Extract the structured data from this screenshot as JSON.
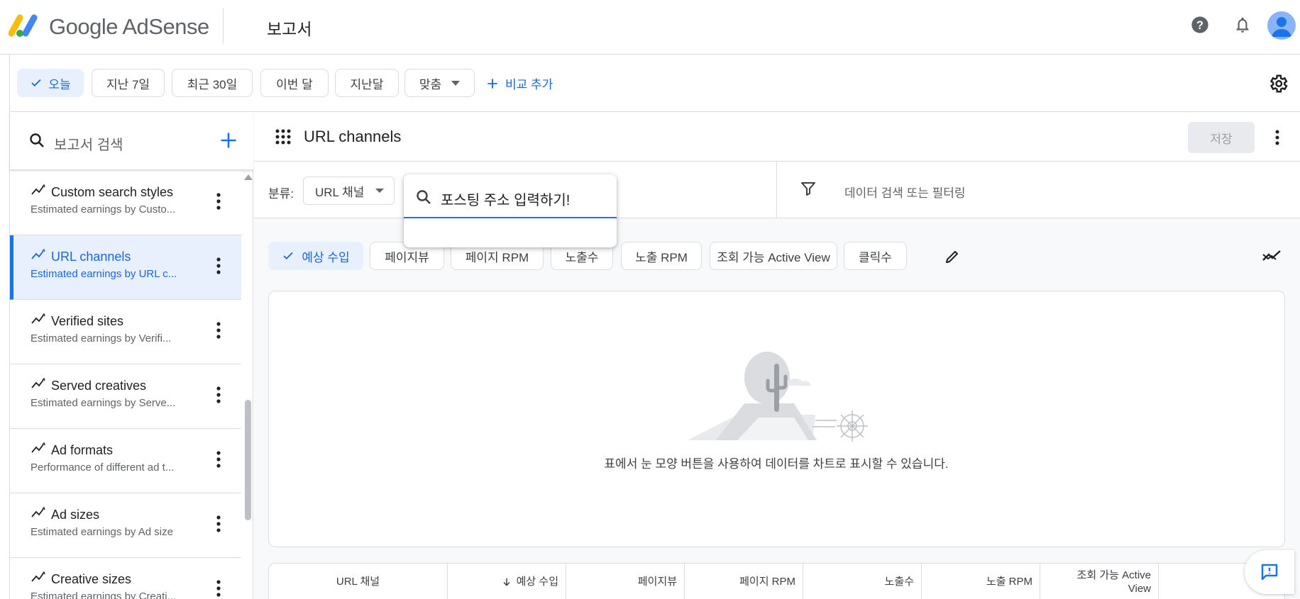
{
  "app": {
    "brand_word1": "Google",
    "brand_word2": "AdSense",
    "page_title": "보고서",
    "icons": [
      "help-icon",
      "notifications-icon",
      "account-avatar"
    ]
  },
  "date_filters": {
    "items": [
      "오늘",
      "지난 7일",
      "최근 30일",
      "이번 달",
      "지난달",
      "맞춤"
    ],
    "selected": "오늘",
    "add_compare": "비교 추가"
  },
  "sidebar": {
    "search_placeholder": "보고서 검색",
    "items": [
      {
        "title": "Custom search styles",
        "subtitle": "Estimated earnings by Custo..."
      },
      {
        "title": "URL channels",
        "subtitle": "Estimated earnings by URL c..."
      },
      {
        "title": "Verified sites",
        "subtitle": "Estimated earnings by Verifi..."
      },
      {
        "title": "Served creatives",
        "subtitle": "Estimated earnings by Serve..."
      },
      {
        "title": "Ad formats",
        "subtitle": "Performance of different ad t..."
      },
      {
        "title": "Ad sizes",
        "subtitle": "Estimated earnings by Ad size"
      },
      {
        "title": "Creative sizes",
        "subtitle": "Estimated earnings by Creati..."
      }
    ],
    "active_index": 1
  },
  "report": {
    "name": "URL channels",
    "save_label": "저장",
    "classification_label": "분류:",
    "classification_value": "URL 채널",
    "filter_placeholder": "데이터 검색 또는 필터링",
    "popover_input": "포스팅 주소 입력하기!"
  },
  "metrics": {
    "items": [
      "예상 수입",
      "페이지뷰",
      "페이지 RPM",
      "노출수",
      "노출 RPM",
      "조회 가능 Active View",
      "클릭수"
    ],
    "selected": "예상 수입"
  },
  "chart": {
    "empty_message": "표에서 눈 모양 버튼을 사용하여 데이터를 차트로 표시할 수 있습니다."
  },
  "table": {
    "headers": [
      "URL 채널",
      "예상 수입",
      "페이지뷰",
      "페이지 RPM",
      "노출수",
      "노출 RPM",
      "조회 가능 Active View",
      "클"
    ],
    "sorted_column": "예상 수입"
  },
  "colors": {
    "accent": "#1a73e8",
    "accent_text": "#1967d2",
    "selected_bg": "#e8f0fe",
    "border": "#dadce0"
  }
}
